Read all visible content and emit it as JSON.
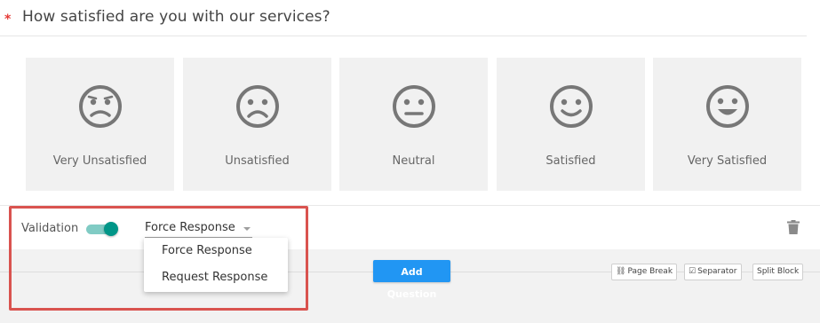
{
  "question": {
    "required_marker": "*",
    "title": "How satisfied are you with our services?"
  },
  "options": [
    {
      "label": "Very Unsatisfied",
      "icon": "very-unsatisfied-face-icon"
    },
    {
      "label": "Unsatisfied",
      "icon": "unsatisfied-face-icon"
    },
    {
      "label": "Neutral",
      "icon": "neutral-face-icon"
    },
    {
      "label": "Satisfied",
      "icon": "satisfied-face-icon"
    },
    {
      "label": "Very Satisfied",
      "icon": "very-satisfied-face-icon"
    }
  ],
  "validation": {
    "label": "Validation",
    "enabled": true,
    "selected": "Force Response",
    "dropdown_options": [
      "Force Response",
      "Request Response"
    ]
  },
  "toolbar": {
    "add_question": "Add Question",
    "page_break": "Page Break",
    "separator": "Separator",
    "split_block": "Split Block"
  },
  "colors": {
    "accent": "#009688",
    "primary_button": "#2196f3",
    "required": "#e53935",
    "highlight_border": "#d9534f"
  }
}
